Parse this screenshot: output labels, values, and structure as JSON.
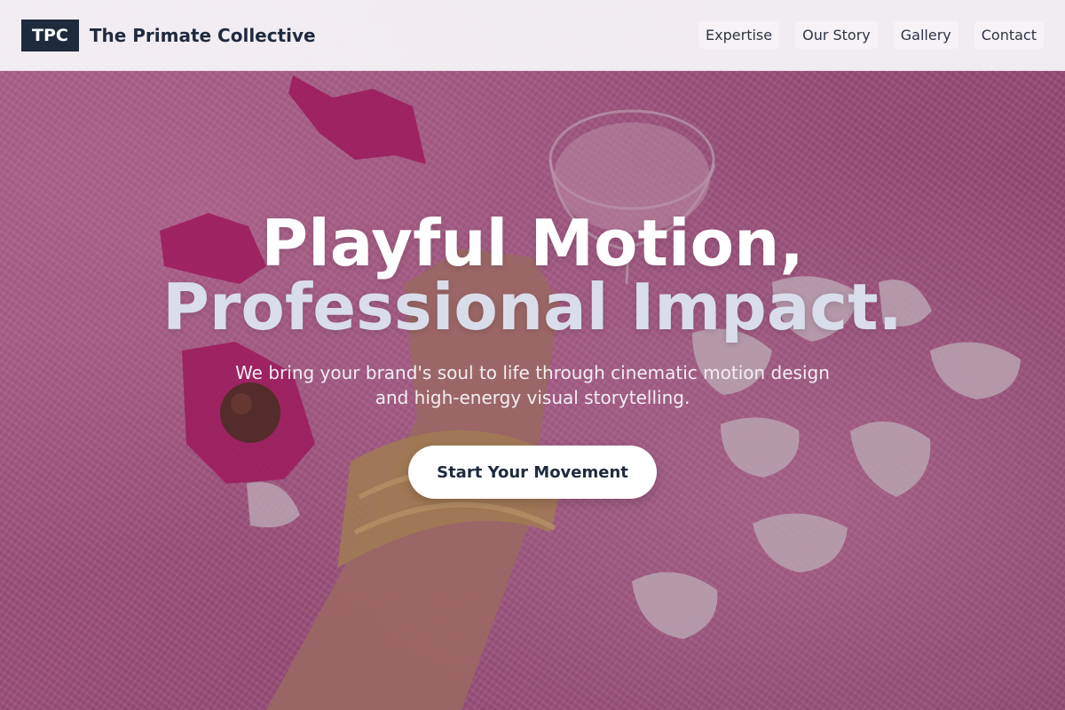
{
  "brand": {
    "logo_text": "TPC",
    "name": "The Primate Collective"
  },
  "nav": {
    "items": [
      {
        "label": "Expertise"
      },
      {
        "label": "Our Story"
      },
      {
        "label": "Gallery"
      },
      {
        "label": "Contact"
      }
    ]
  },
  "hero": {
    "headline_line1": "Playful Motion,",
    "headline_line2": "Professional Impact.",
    "subtitle": "We bring your brand's soul to life through cinematic motion design and high-energy visual storytelling.",
    "cta_label": "Start Your Movement"
  },
  "colors": {
    "primary": "#1f2a3d",
    "background_tint": "#c4679a",
    "button": "#ffffff"
  }
}
